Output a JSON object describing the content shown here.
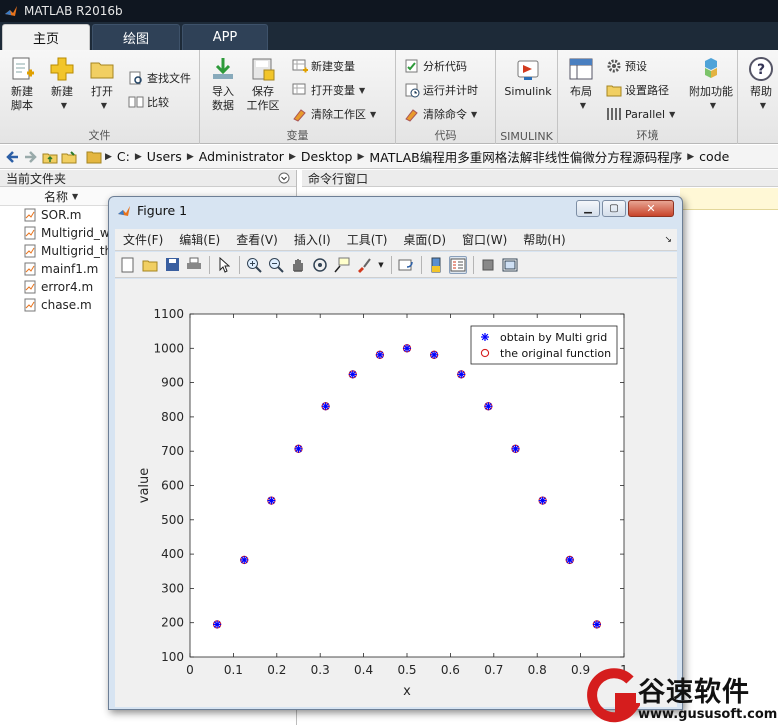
{
  "window": {
    "title": "MATLAB R2016b"
  },
  "tabs": [
    {
      "label": "主页",
      "active": true
    },
    {
      "label": "绘图",
      "active": false
    },
    {
      "label": "APP",
      "active": false
    }
  ],
  "ribbon": {
    "groups": {
      "file": "文件",
      "variable": "变量",
      "code": "代码",
      "simulink": "SIMULINK",
      "environment": "环境"
    },
    "new_script": [
      "新建",
      "脚本"
    ],
    "new": "新建",
    "open": "打开",
    "find_files": "查找文件",
    "compare": "比较",
    "import_data": [
      "导入",
      "数据"
    ],
    "save_workspace": [
      "保存",
      "工作区"
    ],
    "new_variable": "新建变量",
    "open_variable": "打开变量",
    "clear_workspace": "清除工作区",
    "analyze_code": "分析代码",
    "run_and_time": "运行并计时",
    "clear_commands": "清除命令",
    "simulink": "Simulink",
    "layout": "布局",
    "preferences": "预设",
    "set_path": "设置路径",
    "parallel": "Parallel",
    "add_ons": "附加功能",
    "help": "帮助"
  },
  "address": {
    "path": [
      "C:",
      "Users",
      "Administrator",
      "Desktop",
      "MATLAB编程用多重网格法解非线性偏微分方程源码程序",
      "code"
    ]
  },
  "left_panel": {
    "title": "当前文件夹",
    "column_name": "名称",
    "files": [
      "SOR.m",
      "Multigrid_w",
      "Multigrid_th",
      "mainf1.m",
      "error4.m",
      "chase.m"
    ]
  },
  "command_window": {
    "title": "命令行窗口"
  },
  "figure": {
    "title": "Figure 1",
    "menus": [
      "文件(F)",
      "编辑(E)",
      "查看(V)",
      "插入(I)",
      "工具(T)",
      "桌面(D)",
      "窗口(W)",
      "帮助(H)"
    ]
  },
  "chart_data": {
    "type": "scatter",
    "title": "",
    "xlabel": "x",
    "ylabel": "value",
    "xlim": [
      0,
      1
    ],
    "ylim": [
      100,
      1100
    ],
    "xticks": [
      "0",
      "0.1",
      "0.2",
      "0.3",
      "0.4",
      "0.5",
      "0.6",
      "0.7",
      "0.8",
      "0.9",
      "1"
    ],
    "yticks": [
      "100",
      "200",
      "300",
      "400",
      "500",
      "600",
      "700",
      "800",
      "900",
      "1000",
      "1100"
    ],
    "legend_position": "top-right",
    "grid": false,
    "series": [
      {
        "name": "obtain by Multi grid",
        "marker": "*",
        "color": "#0000ff",
        "x": [
          0.0625,
          0.125,
          0.1875,
          0.25,
          0.3125,
          0.375,
          0.4375,
          0.5,
          0.5625,
          0.625,
          0.6875,
          0.75,
          0.8125,
          0.875,
          0.9375
        ],
        "y": [
          195,
          383,
          556,
          707,
          831,
          924,
          981,
          1000,
          981,
          924,
          831,
          707,
          556,
          383,
          195
        ]
      },
      {
        "name": "the original function",
        "marker": "o",
        "color": "#d62020",
        "x": [
          0.0625,
          0.125,
          0.1875,
          0.25,
          0.3125,
          0.375,
          0.4375,
          0.5,
          0.5625,
          0.625,
          0.6875,
          0.75,
          0.8125,
          0.875,
          0.9375
        ],
        "y": [
          195,
          383,
          556,
          707,
          831,
          924,
          981,
          1000,
          981,
          924,
          831,
          707,
          556,
          383,
          195
        ]
      }
    ]
  },
  "watermark": {
    "text": "谷速软件",
    "url": "www.gususoft.com"
  }
}
